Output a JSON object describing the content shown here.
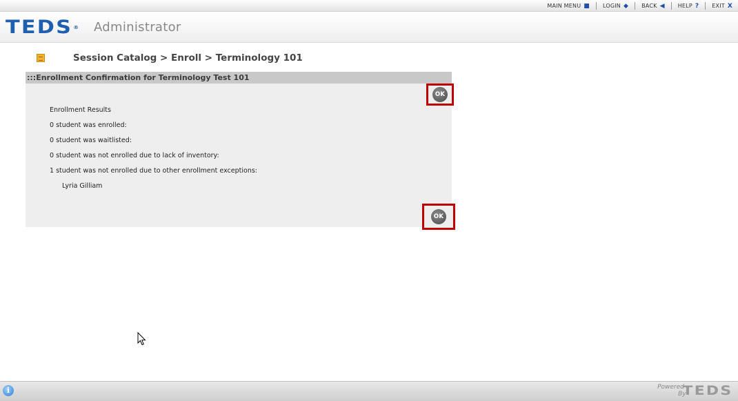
{
  "topnav": {
    "main_menu": "MAIN MENU",
    "main_menu_icon": "square",
    "login": "LOGIN",
    "login_icon": "diamond",
    "back": "BACK",
    "back_icon": "triangle-left",
    "help": "HELP",
    "help_icon": "question-mark",
    "exit": "EXIT",
    "exit_icon": "x"
  },
  "header": {
    "logo": "TEDS",
    "app_title": "Administrator"
  },
  "breadcrumb": "Session Catalog > Enroll > Terminology 101",
  "panel": {
    "title": ":::Enrollment Confirmation for Terminology Test 101",
    "ok_label": "OK",
    "results": {
      "heading": "Enrollment Results",
      "enrolled": "0 student was enrolled:",
      "waitlisted": "0 student was waitlisted:",
      "no_inventory": "0 student was not enrolled due to lack of inventory:",
      "exceptions": "1 student was not enrolled due to other enrollment exceptions:",
      "exception_student": "Lyria Gilliam"
    }
  },
  "footer": {
    "powered": "Powered",
    "by": "By",
    "logo": "TEDS"
  },
  "colors": {
    "brand_blue": "#1f5fb0",
    "highlight_red": "#c00000",
    "panel_bg": "#eeeeee",
    "panel_title_bg": "#c8c8c8"
  }
}
